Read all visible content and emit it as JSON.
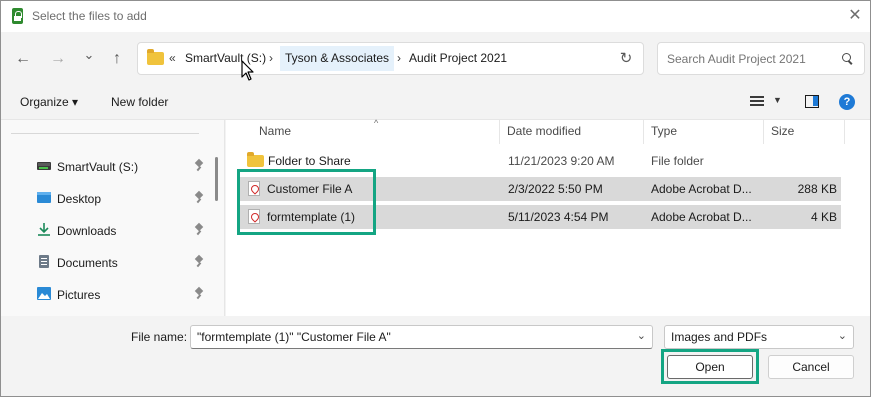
{
  "window": {
    "title": "Select the files to add",
    "close_glyph": "✕",
    "accent_color": "#1e7ad6",
    "highlight_color": "#14a583"
  },
  "nav": {
    "back_glyph": "←",
    "forward_glyph": "→",
    "recent_glyph": "⌄",
    "up_glyph": "↑",
    "overflow_glyph": "«",
    "breadcrumbs": [
      "SmartVault (S:)",
      "Tyson & Associates",
      "Audit Project 2021"
    ],
    "separator": "›",
    "refresh_glyph": "↻",
    "search_placeholder": "Search Audit Project 2021"
  },
  "toolbar": {
    "organize_label": "Organize ▾",
    "new_folder_label": "New folder",
    "view_caret": "▼",
    "help_glyph": "?"
  },
  "sidebar": {
    "items": [
      {
        "label": "SmartVault (S:)",
        "icon": "drive-icon"
      },
      {
        "label": "Desktop",
        "icon": "desktop-icon"
      },
      {
        "label": "Downloads",
        "icon": "downloads-icon"
      },
      {
        "label": "Documents",
        "icon": "documents-icon"
      },
      {
        "label": "Pictures",
        "icon": "pictures-icon"
      }
    ]
  },
  "filelist": {
    "columns": [
      "Name",
      "Date modified",
      "Type",
      "Size"
    ],
    "sort_glyph": "^",
    "rows": [
      {
        "name": "Folder to Share",
        "date": "11/21/2023 9:20 AM",
        "type": "File folder",
        "size": "",
        "icon": "folder-icon",
        "selected": false
      },
      {
        "name": "Customer File A",
        "date": "2/3/2022 5:50 PM",
        "type": "Adobe Acrobat D...",
        "size": "288 KB",
        "icon": "pdf-icon",
        "selected": true
      },
      {
        "name": "formtemplate (1)",
        "date": "5/11/2023 4:54 PM",
        "type": "Adobe Acrobat D...",
        "size": "4 KB",
        "icon": "pdf-icon",
        "selected": true
      }
    ]
  },
  "footer": {
    "file_name_label": "File name:",
    "file_name_value": "\"formtemplate (1)\" \"Customer File A\"",
    "dropdown_glyph": "⌄",
    "file_type": "Images and PDFs",
    "open_label": "Open",
    "cancel_label": "Cancel"
  }
}
